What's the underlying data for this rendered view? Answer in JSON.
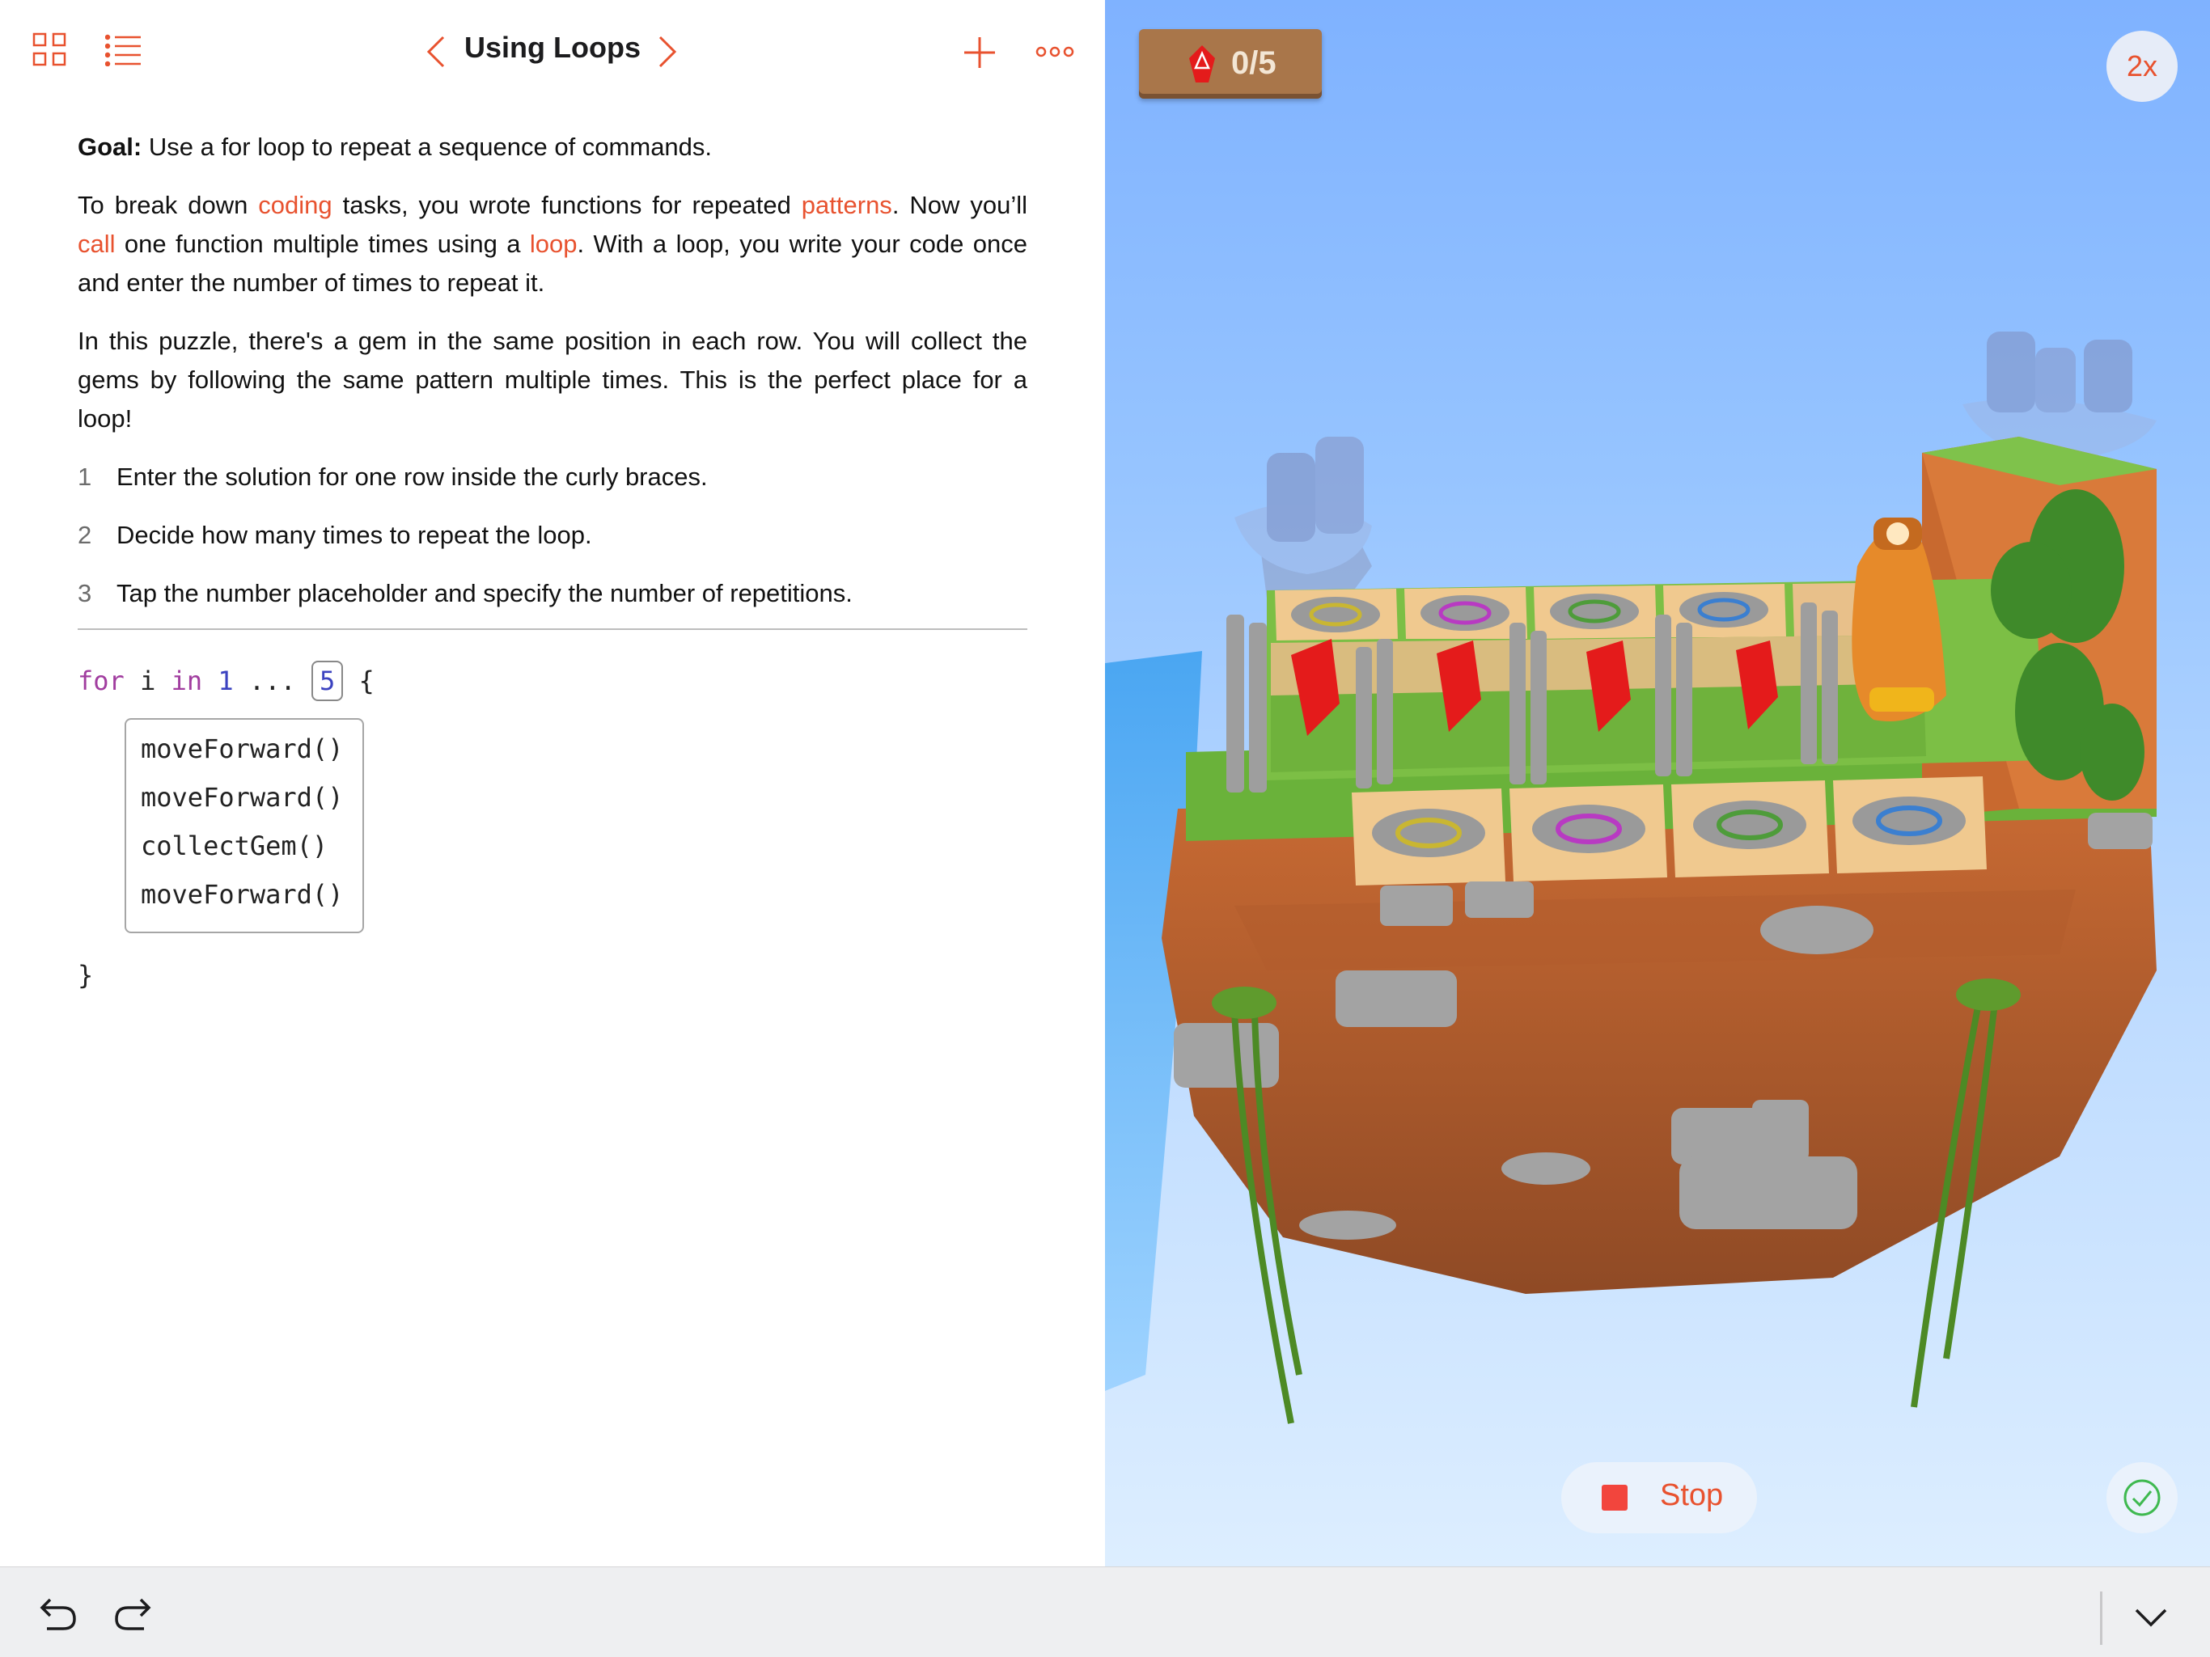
{
  "header": {
    "title": "Using Loops",
    "icons": [
      "grid-icon",
      "list-icon",
      "chevron-left-icon",
      "chevron-right-icon",
      "plus-icon",
      "more-icon"
    ]
  },
  "instructions": {
    "goal_label": "Goal:",
    "goal_text": " Use a for loop to repeat a sequence of commands.",
    "p1": {
      "t1": "To break down ",
      "link1": "coding",
      "t2": " tasks, you wrote functions for repeated ",
      "link2": "patterns",
      "t3": ". Now you’ll ",
      "link3": "call",
      "t4": " one function multiple times using a ",
      "link4": "loop",
      "t5": ". With a loop, you write your code once and enter the number of times to repeat it."
    },
    "p2": "In this puzzle, there's a gem in the same position in each row. You will collect the gems by following the same pattern multiple times. This is the perfect place for a loop!",
    "steps": [
      {
        "num": "1",
        "text": "Enter the solution for one row inside the curly braces."
      },
      {
        "num": "2",
        "text": "Decide how many times to repeat the loop."
      },
      {
        "num": "3",
        "text": "Tap the number placeholder and specify the number of repetitions."
      }
    ]
  },
  "code": {
    "kw_for": "for",
    "var": " i ",
    "kw_in": "in",
    "range_start": " 1",
    "range_op": " ... ",
    "count": "5",
    "open_brace": " {",
    "body": [
      "moveForward()",
      "moveForward()",
      "collectGem()",
      "moveForward()"
    ],
    "close_brace": "}"
  },
  "liveview": {
    "gem_counter": "0/5",
    "gems_collected": 0,
    "gems_total": 5,
    "speed": "2x",
    "stop_label": "Stop",
    "accent": "#e8522f",
    "stop_color": "#f2453d",
    "check_color": "#3fb950"
  },
  "bottombar": {
    "icons": [
      "undo-icon",
      "redo-icon",
      "chevron-down-icon"
    ]
  }
}
